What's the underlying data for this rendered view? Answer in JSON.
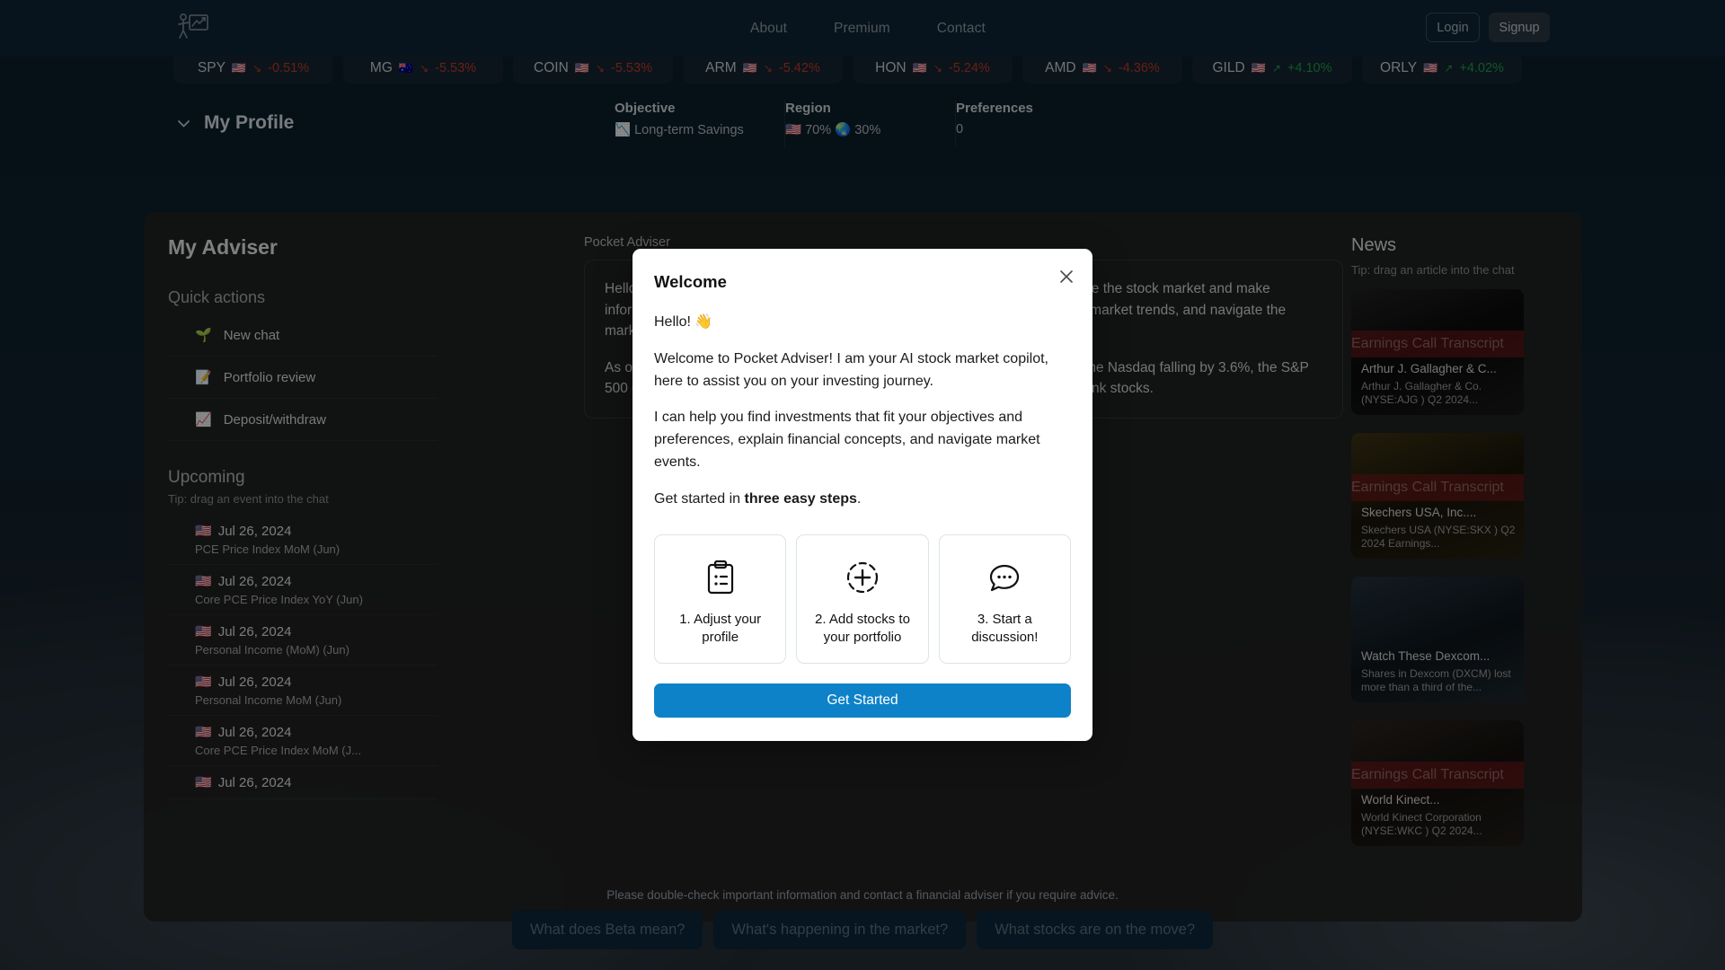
{
  "header": {
    "logo_icon": "presenter-chart-icon",
    "nav": [
      {
        "label": "About"
      },
      {
        "label": "Premium"
      },
      {
        "label": "Contact"
      }
    ],
    "login_label": "Login",
    "signup_label": "Signup"
  },
  "tickers": [
    {
      "symbol": "SPY",
      "flag": "🇺🇸",
      "change": "-0.51%",
      "direction": "down"
    },
    {
      "symbol": "MG",
      "flag": "🇦🇺",
      "change": "-5.53%",
      "direction": "down"
    },
    {
      "symbol": "COIN",
      "flag": "🇺🇸",
      "change": "-5.53%",
      "direction": "down"
    },
    {
      "symbol": "ARM",
      "flag": "🇺🇸",
      "change": "-5.42%",
      "direction": "down"
    },
    {
      "symbol": "HON",
      "flag": "🇺🇸",
      "change": "-5.24%",
      "direction": "down"
    },
    {
      "symbol": "AMD",
      "flag": "🇺🇸",
      "change": "-4.36%",
      "direction": "down"
    },
    {
      "symbol": "GILD",
      "flag": "🇺🇸",
      "change": "+4.10%",
      "direction": "up"
    },
    {
      "symbol": "ORLY",
      "flag": "🇺🇸",
      "change": "+4.02%",
      "direction": "up"
    }
  ],
  "profile": {
    "title": "My Profile",
    "chevron_icon": "chevron-down-icon",
    "cells": [
      {
        "label": "Objective",
        "emoji": "📉",
        "value": "Long-term Savings"
      },
      {
        "label": "Region",
        "emoji": "",
        "value": "🇺🇸 70% 🌏 30%"
      },
      {
        "label": "Preferences",
        "emoji": "",
        "value": "0"
      }
    ]
  },
  "sidebar": {
    "title": "My Adviser",
    "quick_actions_label": "Quick actions",
    "quick_actions": [
      {
        "emoji": "🌱",
        "label": "New chat"
      },
      {
        "emoji": "📝",
        "label": "Portfolio review"
      },
      {
        "emoji": "📈",
        "label": "Deposit/withdraw"
      }
    ],
    "upcoming_label": "Upcoming",
    "upcoming_tip": "Tip: drag an event into the chat",
    "events": [
      {
        "flag": "🇺🇸",
        "date": "Jul 26, 2024",
        "name": "PCE Price Index MoM (Jun)"
      },
      {
        "flag": "🇺🇸",
        "date": "Jul 26, 2024",
        "name": "Core PCE Price Index YoY (Jun)"
      },
      {
        "flag": "🇺🇸",
        "date": "Jul 26, 2024",
        "name": "Personal Income (MoM) (Jun)"
      },
      {
        "flag": "🇺🇸",
        "date": "Jul 26, 2024",
        "name": "Personal Income MoM (Jun)"
      },
      {
        "flag": "🇺🇸",
        "date": "Jul 26, 2024",
        "name": "Core PCE Price Index MoM (J..."
      },
      {
        "flag": "🇺🇸",
        "date": "Jul 26, 2024",
        "name": ""
      }
    ]
  },
  "chat": {
    "author": "Pocket Adviser",
    "paragraphs": [
      "Hello! 👋 I'm your enthusiastic AI stock market copilot, here to help you navigate the stock market and make informed investment decisions. I can assist you with your portfolio, understand market trends, and navigate the market.",
      "As of today, July 26th, 2024, the market has seen a significant downturn, with the Nasdaq falling by 3.6%, the S&P 500 dropping 2.3%, amid disappointing tech earnings and rising tensions on bank stocks."
    ]
  },
  "news": {
    "title": "News",
    "tip": "Tip: drag an article into the chat",
    "articles": [
      {
        "band": "Earnings Call Transcript",
        "headline": "Arthur J. Gallagher & C...",
        "description": "Arthur J. Gallagher & Co. (NYSE:AJG ) Q2 2024..."
      },
      {
        "band": "Earnings Call Transcript",
        "headline": "Skechers USA, Inc....",
        "description": "Skechers USA (NYSE:SKX ) Q2 2024 Earnings..."
      },
      {
        "band": "",
        "headline": "Watch These Dexcom...",
        "description": "Shares in Dexcom (DXCM) lost more than a third of the..."
      },
      {
        "band": "Earnings Call Transcript",
        "headline": "World Kinect...",
        "description": "World Kinect Corporation (NYSE:WKC ) Q2 2024..."
      }
    ]
  },
  "footer": {
    "disclaimer": "Please double-check important information and contact a financial adviser if you require advice.",
    "chips": [
      {
        "label": "What does Beta mean?"
      },
      {
        "label": "What's happening in the market?"
      },
      {
        "label": "What stocks are on the move?"
      }
    ]
  },
  "modal": {
    "title": "Welcome",
    "close_icon": "close-icon",
    "greeting": "Hello! 👋",
    "paragraph1": "Welcome to Pocket Adviser! I am your AI stock market copilot, here to assist you on your investing journey.",
    "paragraph2": "I can help you find investments that fit your objectives and preferences, explain financial concepts, and navigate market events.",
    "cta_prefix": "Get started in ",
    "cta_bold": "three easy steps",
    "cta_suffix": ".",
    "steps": [
      {
        "icon": "clipboard-list-icon",
        "label": "1. Adjust your profile"
      },
      {
        "icon": "circle-plus-dashed-icon",
        "label": "2. Add stocks to your portfolio"
      },
      {
        "icon": "chat-bubble-dots-icon",
        "label": "3. Start a discussion!"
      }
    ],
    "button_label": "Get Started"
  },
  "colors": {
    "accent_blue": "#0d82c8",
    "down_red": "#c0392b",
    "up_green": "#1d9e4b",
    "header_bg": "#0d2535"
  }
}
